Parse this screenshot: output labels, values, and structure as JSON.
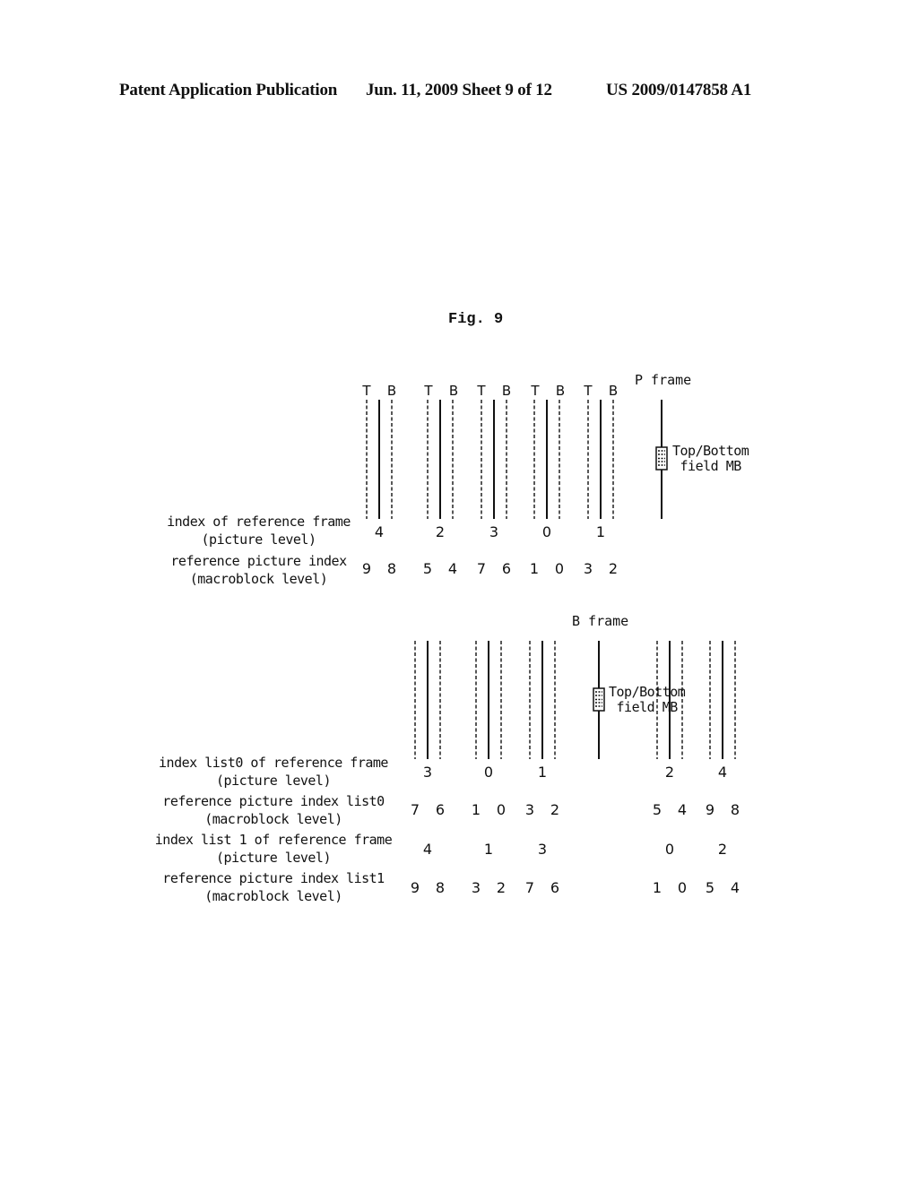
{
  "header": {
    "publication": "Patent Application Publication",
    "date_sheet": "Jun. 11, 2009  Sheet 9 of 12",
    "patent_number": "US 2009/0147858 A1"
  },
  "figure": {
    "title": "Fig. 9",
    "p_frame": {
      "frame_label": "P frame",
      "mb_label_line1": "Top/Bottom",
      "mb_label_line2": "field MB",
      "field_labels": [
        "T",
        "B",
        "T",
        "B",
        "T",
        "B",
        "T",
        "B",
        "T",
        "B"
      ],
      "row_labels": {
        "picture_index_1": "index of reference frame",
        "picture_index_2": "(picture level)",
        "mb_index_1": "reference picture index",
        "mb_index_2": "(macroblock level)"
      },
      "picture_level_indices": [
        "4",
        "2",
        "3",
        "0",
        "1"
      ],
      "macroblock_level_indices": [
        "9",
        "8",
        "5",
        "4",
        "7",
        "6",
        "1",
        "0",
        "3",
        "2"
      ]
    },
    "b_frame": {
      "frame_label": "B frame",
      "mb_label_line1": "Top/Bottom",
      "mb_label_line2": "field MB",
      "row_labels": {
        "list0_picture_1": "index list0 of reference frame",
        "list0_picture_2": "(picture level)",
        "list0_mb_1": "reference picture index list0",
        "list0_mb_2": "(macroblock level)",
        "list1_picture_1": "index list 1 of reference frame",
        "list1_picture_2": "(picture level)",
        "list1_mb_1": "reference picture index list1",
        "list1_mb_2": "(macroblock level)"
      },
      "list0_picture_indices": [
        "3",
        "0",
        "1",
        "2",
        "4"
      ],
      "list0_macroblock_indices": [
        "7",
        "6",
        "1",
        "0",
        "3",
        "2",
        "5",
        "4",
        "9",
        "8"
      ],
      "list1_picture_indices": [
        "4",
        "1",
        "3",
        "0",
        "2"
      ],
      "list1_macroblock_indices": [
        "9",
        "8",
        "3",
        "2",
        "7",
        "6",
        "1",
        "0",
        "5",
        "4"
      ]
    }
  }
}
